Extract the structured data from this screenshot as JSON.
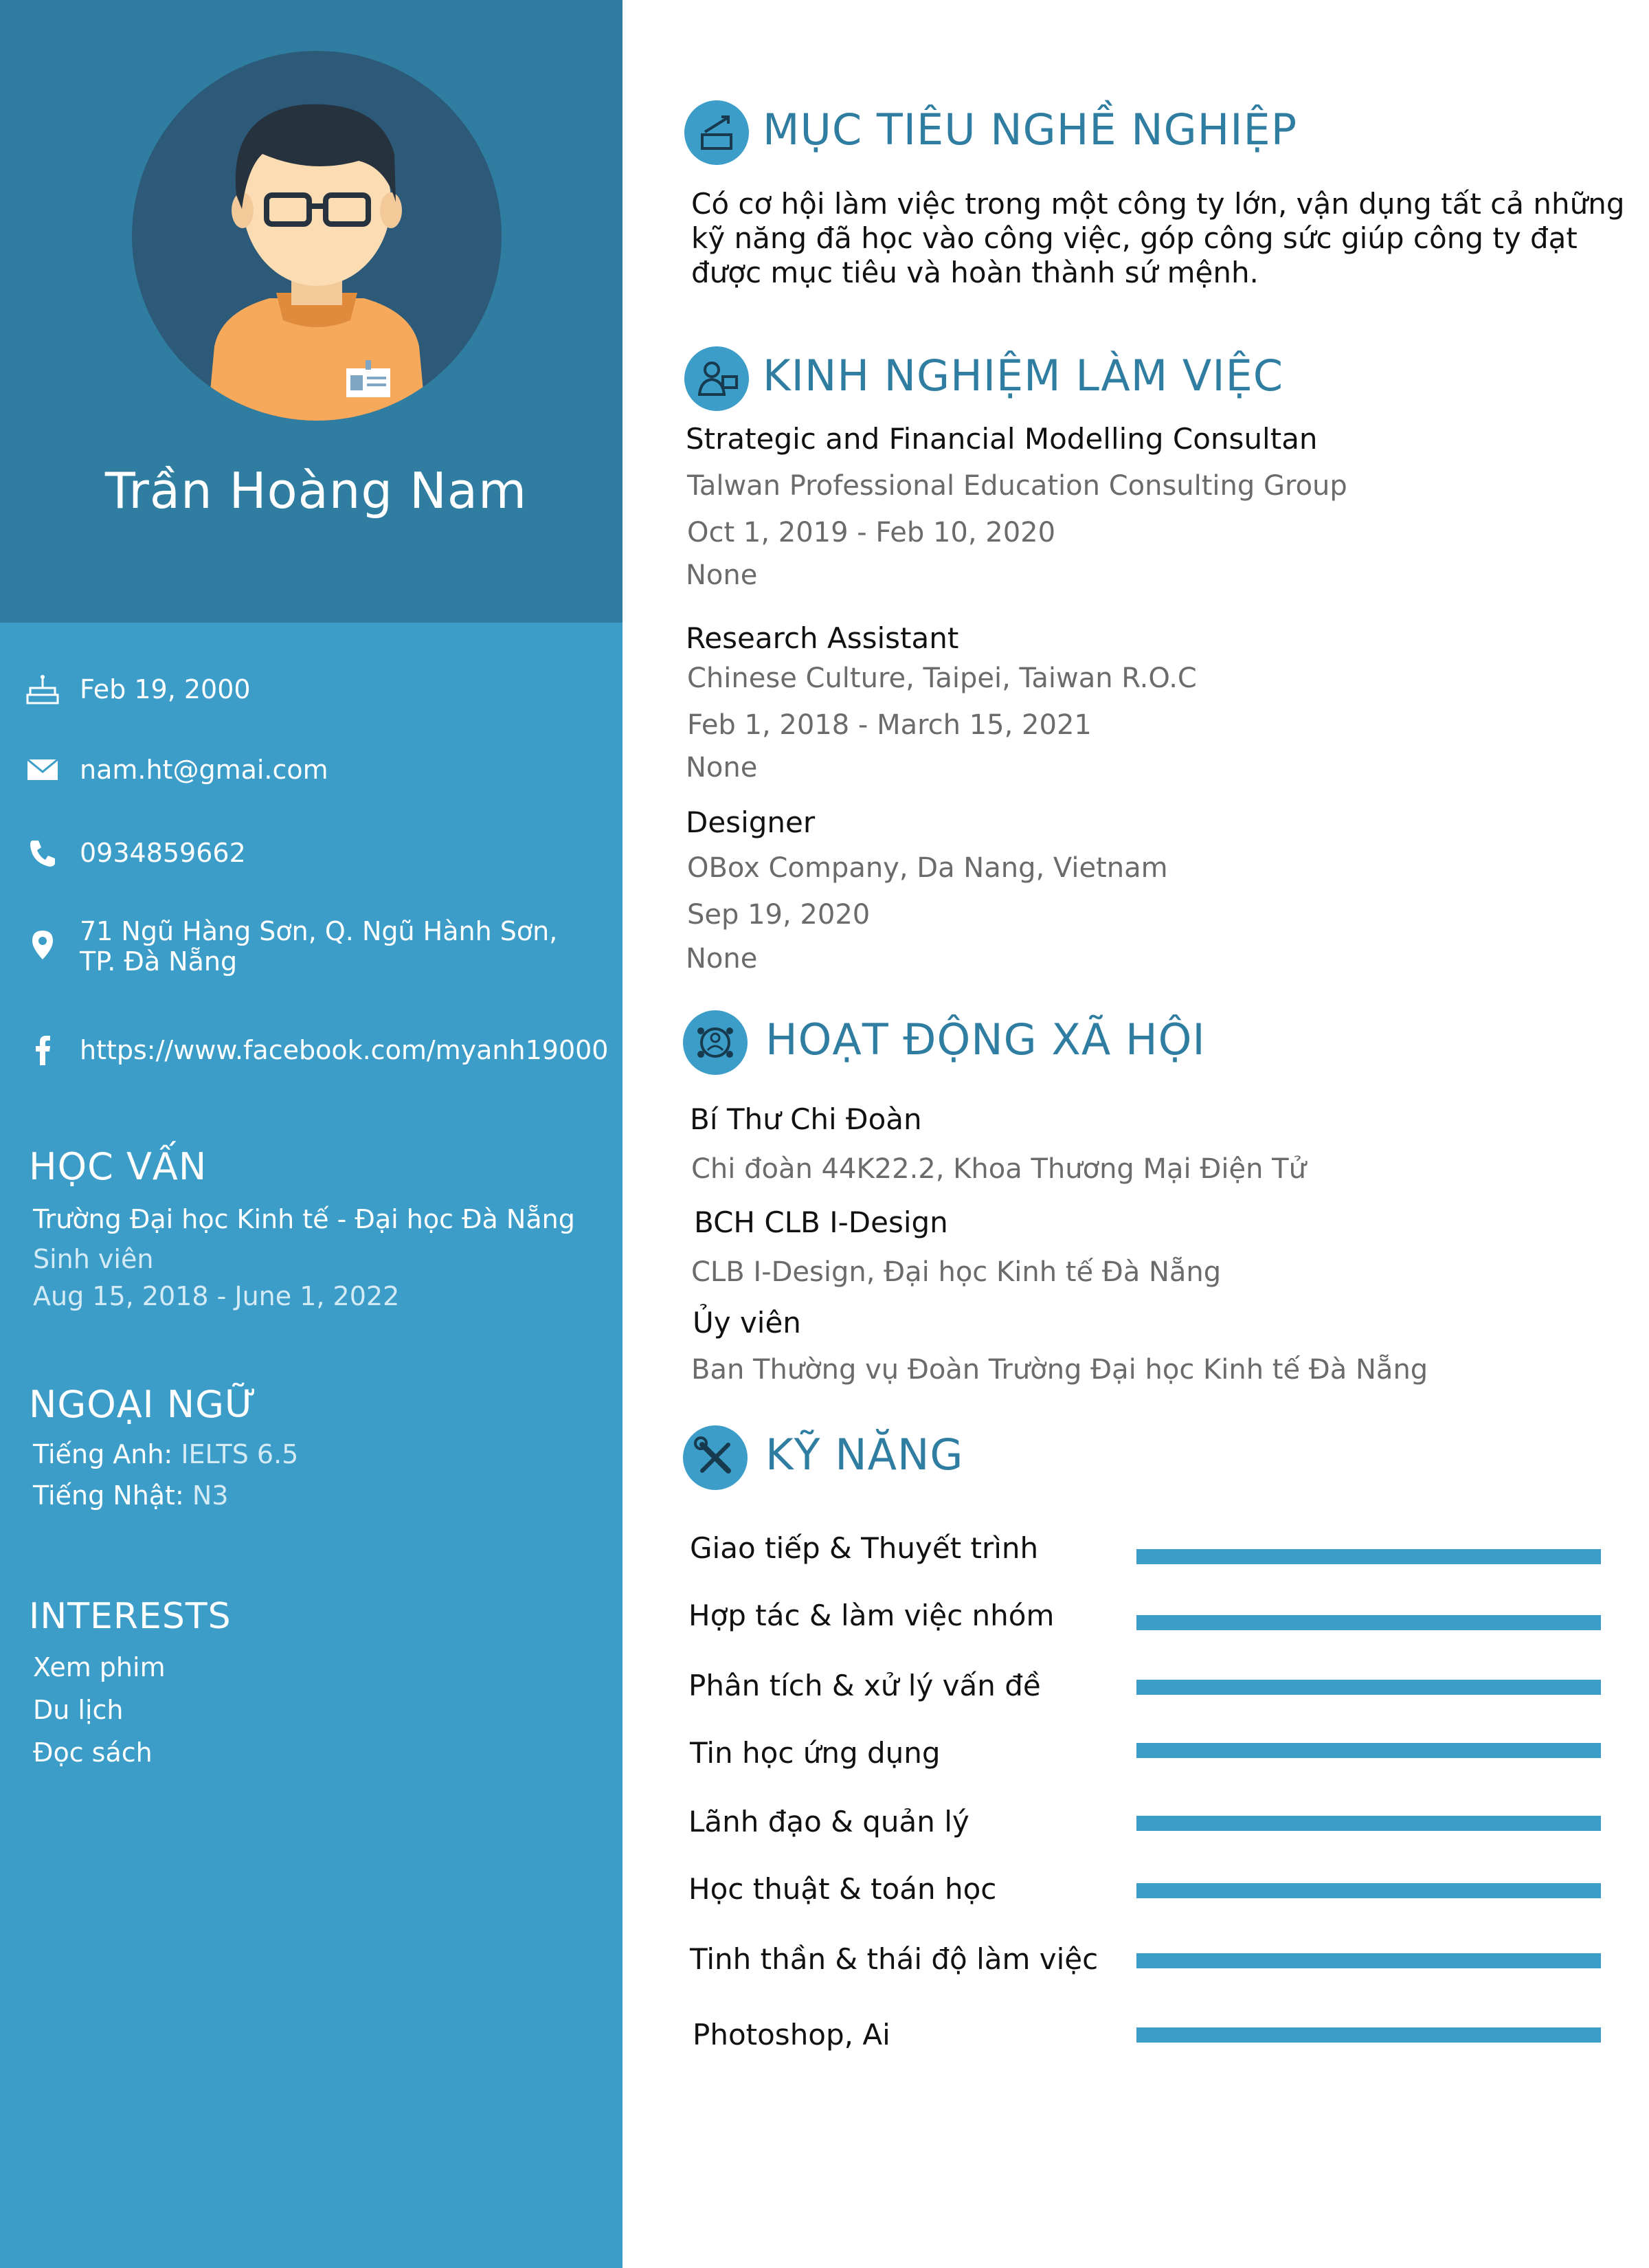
{
  "profile": {
    "name": "Trần Hoàng Nam"
  },
  "contact": {
    "birthday": "Feb 19, 2000",
    "email": "nam.ht@gmai.com",
    "phone": "0934859662",
    "address_line1": "71 Ngũ Hàng Sơn, Q. Ngũ Hành Sơn,",
    "address_line2": "TP. Đà Nẵng",
    "facebook": "https://www.facebook.com/myanh19000"
  },
  "education": {
    "heading": "HỌC VẤN",
    "school": "Trường Đại học Kinh tế - Đại học Đà Nẵng",
    "role": "Sinh viên",
    "period": "Aug 15, 2018 - June 1, 2022"
  },
  "languages": {
    "heading": "NGOẠI NGỮ",
    "items": [
      {
        "label": "Tiếng Anh:",
        "value": "IELTS 6.5"
      },
      {
        "label": "Tiếng Nhật:",
        "value": "N3"
      }
    ]
  },
  "interests": {
    "heading": "INTERESTS",
    "items": [
      "Xem phim",
      "Du lịch",
      "Đọc sách"
    ]
  },
  "objective": {
    "title": "MỤC TIÊU NGHỀ NGHIỆP",
    "text": "Có cơ hội làm việc trong một công ty lớn, vận dụng tất cả những kỹ năng đã học vào công việc, góp công sức giúp công ty đạt được mục tiêu và hoàn thành sứ mệnh."
  },
  "experience": {
    "title": "KINH NGHIỆM LÀM VIỆC",
    "jobs": [
      {
        "title": "Strategic and Financial Modelling Consultan",
        "org": "Talwan Professional Education Consulting Group",
        "period": "Oct 1, 2019 - Feb 10, 2020",
        "note": "None"
      },
      {
        "title": "Research Assistant",
        "org": "Chinese Culture, Taipei, Taiwan R.O.C",
        "period": "Feb 1, 2018 - March 15, 2021",
        "note": "None"
      },
      {
        "title": "Designer",
        "org": "OBox Company, Da Nang, Vietnam",
        "period": "Sep 19, 2020",
        "note": "None"
      }
    ]
  },
  "activities": {
    "title": "HOẠT ĐỘNG XÃ HỘI",
    "items": [
      {
        "role": "Bí Thư Chi Đoàn",
        "org": "Chi đoàn 44K22.2, Khoa Thương Mại Điện Tử"
      },
      {
        "role": "BCH CLB I-Design",
        "org": "CLB I-Design, Đại học Kinh tế Đà Nẵng"
      },
      {
        "role": "Ủy viên",
        "org": "Ban Thường vụ Đoàn Trường Đại học Kinh tế Đà Nẵng"
      }
    ]
  },
  "skills": {
    "title": "KỸ NĂNG",
    "items": [
      {
        "name": "Giao tiếp & Thuyết trình",
        "level": 1.0
      },
      {
        "name": "Hợp tác & làm việc nhóm",
        "level": 1.0
      },
      {
        "name": "Phân tích & xử lý vấn đề",
        "level": 1.0
      },
      {
        "name": "Tin học ứng dụng",
        "level": 1.0
      },
      {
        "name": "Lãnh đạo & quản lý",
        "level": 1.0
      },
      {
        "name": "Học thuật & toán học",
        "level": 1.0
      },
      {
        "name": "Tinh thần & thái độ làm việc",
        "level": 1.0
      },
      {
        "name": "Photoshop, Ai",
        "level": 1.0
      }
    ]
  },
  "colors": {
    "sidebar": "#3b9dc8",
    "sidebar_top": "#2f7da1",
    "heading": "#2f7da1",
    "skill_bar": "#3b9dc8"
  }
}
